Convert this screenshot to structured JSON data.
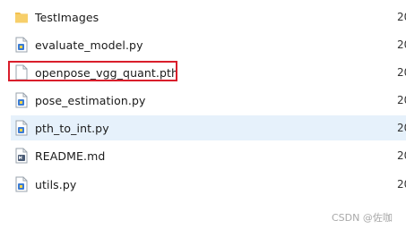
{
  "files": [
    {
      "name": "TestImages",
      "icon": "folder-icon",
      "date_fragment": "20",
      "selected": false
    },
    {
      "name": "evaluate_model.py",
      "icon": "python-file-icon",
      "date_fragment": "20",
      "selected": false
    },
    {
      "name": "openpose_vgg_quant.pth",
      "icon": "blank-file-icon",
      "date_fragment": "20",
      "selected": false
    },
    {
      "name": "pose_estimation.py",
      "icon": "python-file-icon",
      "date_fragment": "20",
      "selected": false
    },
    {
      "name": "pth_to_int.py",
      "icon": "python-file-icon",
      "date_fragment": "20",
      "selected": true
    },
    {
      "name": "README.md",
      "icon": "markdown-file-icon",
      "date_fragment": "20",
      "selected": false
    },
    {
      "name": "utils.py",
      "icon": "python-file-icon",
      "date_fragment": "20",
      "selected": false
    }
  ],
  "highlight": {
    "target": "openpose_vgg_quant.pth",
    "color": "#d91e2b"
  },
  "watermark": {
    "text": "CSDN @佐咖"
  },
  "colors": {
    "selection": "#e6f1fb",
    "folder": "#f3c14f",
    "python_badge": "#3a7bd5"
  }
}
